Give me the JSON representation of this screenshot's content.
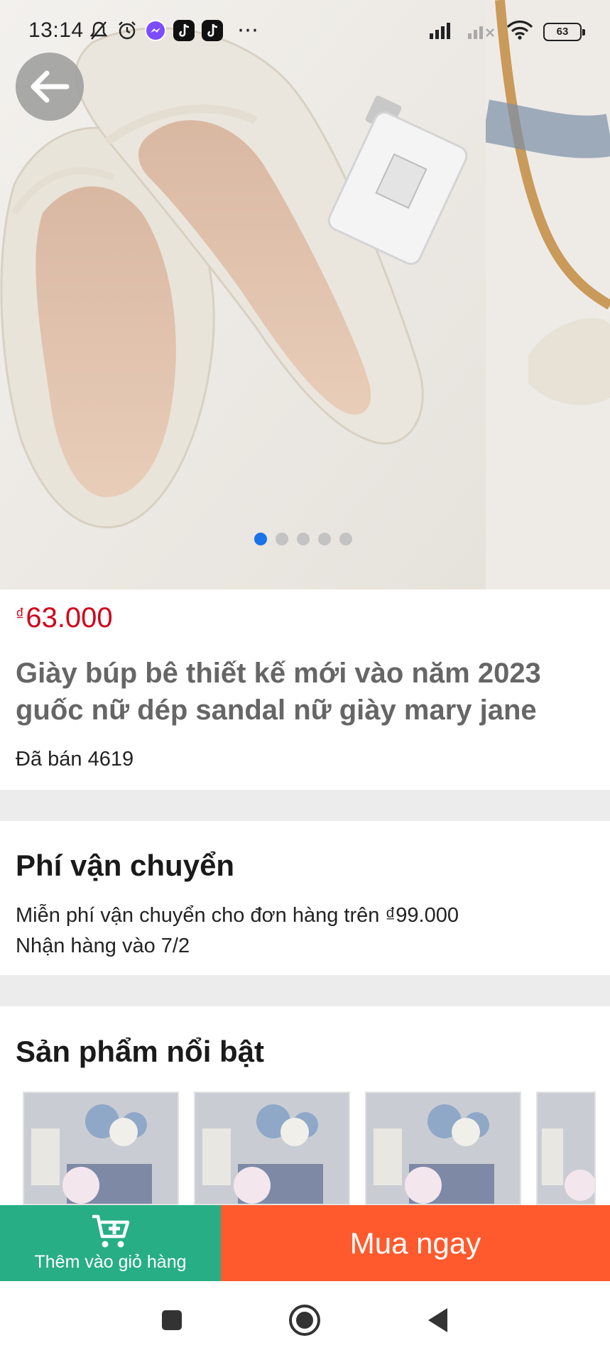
{
  "status_bar": {
    "time": "13:14",
    "battery": "63",
    "more": "⋯"
  },
  "gallery": {
    "total_images": 5,
    "active_index": 0
  },
  "product": {
    "currency_symbol": "₫",
    "price": "63.000",
    "title": "Giày búp bê thiết kế mới vào năm 2023 guốc nữ dép sandal nữ giày mary jane",
    "sold": "Đã bán 4619"
  },
  "shipping": {
    "title": "Phí vận chuyển",
    "free_shipping": "Miễn phí vận chuyển cho đơn hàng trên ₫99.000",
    "delivery": "Nhận hàng vào 7/2"
  },
  "featured": {
    "title": "Sản phẩm nổi bật",
    "count_visible": 4
  },
  "actions": {
    "add_to_cart": "Thêm vào giỏ hàng",
    "buy_now": "Mua ngay"
  },
  "colors": {
    "price": "#d0021b",
    "add_to_cart_bg": "#27ae84",
    "buy_now_bg": "#ff5a2d",
    "active_dot": "#1a73e8"
  },
  "icons": {
    "back": "arrow-left-icon",
    "cart": "cart-plus-icon",
    "nav_recent": "square-icon",
    "nav_home": "circle-icon",
    "nav_back": "triangle-back-icon"
  }
}
